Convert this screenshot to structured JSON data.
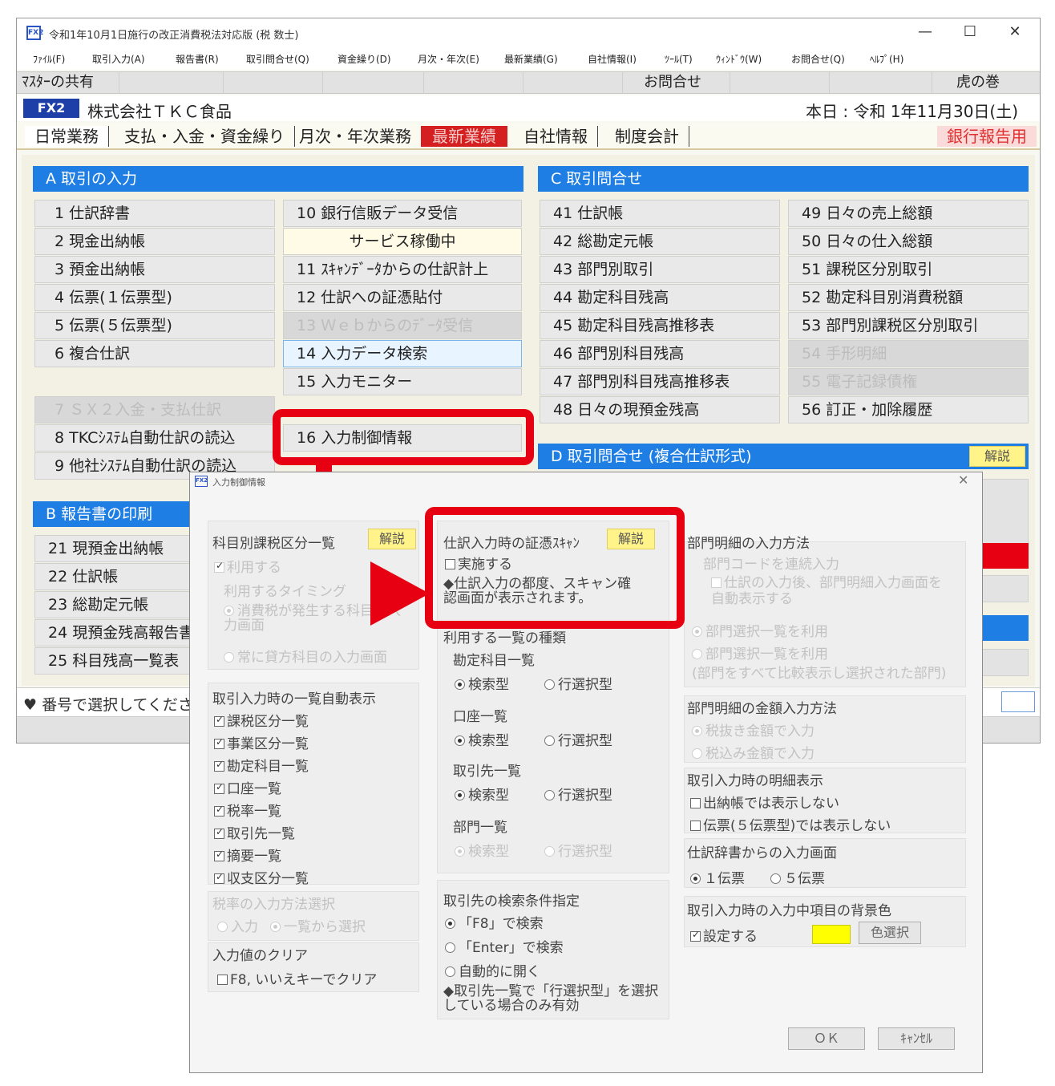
{
  "window": {
    "icon": "FX2",
    "title": "令和1年10月1日施行の改正消費税法対応版 (税 数士)",
    "controls": [
      "—",
      "☐",
      "✕"
    ]
  },
  "menu": [
    "ﾌｧｲﾙ(F)",
    "取引入力(A)",
    "報告書(R)",
    "取引問合せ(Q)",
    "資金繰り(D)",
    "月次・年次(E)",
    "最新業績(G)",
    "自社情報(I)",
    "ﾂｰﾙ(T)",
    "ｳｨﾝﾄﾞｳ(W)",
    "お問合せ(Q)",
    "ﾍﾙﾌﾟ(H)"
  ],
  "sharebar": {
    "label": "ﾏｽﾀｰの共有",
    "inquiry": "お問合せ",
    "tora": "虎の巻"
  },
  "company": {
    "badge": "FX2",
    "name": "株式会社ＴＫＣ食品",
    "today": "本日 : 令和 1年11月30日(土)"
  },
  "tabs": [
    "日常業務",
    "支払・入金・資金繰り",
    "月次・年次業務",
    "最新業績",
    "自社情報",
    "制度会計"
  ],
  "report_tab": "銀行報告用",
  "sectionA": {
    "title": "A 取引の入力",
    "left": [
      "1 仕訳辞書",
      "2 現金出納帳",
      "3 預金出納帳",
      "4 伝票(１伝票型)",
      "5 伝票(５伝票型)",
      "6 複合仕訳"
    ],
    "right": [
      "10 銀行信販データ受信",
      "サービス稼働中",
      "11 ｽｷｬﾝﾃﾞｰﾀからの仕訳計上",
      "12 仕訳への証憑貼付",
      "13 Ｗｅｂからのﾃﾞｰﾀ受信",
      "14 入力データ検索",
      "15 入力モニター"
    ],
    "left2": [
      "7 ＳＸ２入金・支払仕訳",
      "8 TKCｼｽﾃﾑ自動仕訳の読込",
      "9 他社ｼｽﾃﾑ自動仕訳の読込"
    ],
    "highlight": "16 入力制御情報"
  },
  "sectionB": {
    "title": "B 報告書の印刷",
    "items": [
      "21 現預金出納帳",
      "22 仕訳帳",
      "23 総勘定元帳",
      "24 現預金残高報告書",
      "25 科目残高一覧表"
    ]
  },
  "sectionC": {
    "title": "C 取引問合せ",
    "col1": [
      "41 仕訳帳",
      "42 総勘定元帳",
      "43 部門別取引",
      "44 勘定科目残高",
      "45 勘定科目残高推移表",
      "46 部門別科目残高",
      "47 部門別科目残高推移表",
      "48 日々の現預金残高"
    ],
    "col2": [
      "49 日々の売上総額",
      "50 日々の仕入総額",
      "51 課税区分別取引",
      "52 勘定科目別消費税額",
      "53 部門別課税区分別取引",
      "54 手形明細",
      "55 電子記録債権",
      "56 訂正・加除履歴"
    ]
  },
  "sectionD": {
    "title": "D 取引問合せ (複合仕訳形式)",
    "help": "解説"
  },
  "status": "♥ 番号で選択してください",
  "dialog": {
    "icon": "FX2",
    "title": "入力制御情報",
    "close": "✕",
    "col1": {
      "g1_title": "科目別課税区分一覧",
      "help": "解説",
      "use": "利用する",
      "type_title": "利用するタイミング",
      "opt1": "消費税が発生する科目の入力画面",
      "opt2": "常に貸方科目の入力画面",
      "g2_title": "取引入力時の一覧自動表示",
      "list": [
        "課税区分一覧",
        "事業区分一覧",
        "勘定科目一覧",
        "口座一覧",
        "税率一覧",
        "取引先一覧",
        "摘要一覧",
        "収支区分一覧"
      ],
      "g3_title": "税率の入力方法選択",
      "g3_opts": [
        "入力",
        "一覧から選択"
      ],
      "g4_title": "入力値のクリア",
      "g4_opt": "F8, いいえキーでクリア"
    },
    "col2": {
      "g1_title": "仕訳入力時の証憑ｽｷｬﾝ",
      "help": "解説",
      "do": "実施する",
      "note": "◆仕訳入力の都度、スキャン確認画面が表示されます。",
      "g2_title": "利用する一覧の種類",
      "groups": [
        {
          "name": "勘定科目一覧",
          "a": "検索型",
          "b": "行選択型"
        },
        {
          "name": "口座一覧",
          "a": "検索型",
          "b": "行選択型"
        },
        {
          "name": "取引先一覧",
          "a": "検索型",
          "b": "行選択型"
        },
        {
          "name": "部門一覧",
          "a": "検索型",
          "b": "行選択型"
        }
      ],
      "g3_title": "取引先の検索条件指定",
      "g3_opts": [
        "「F8」で検索",
        "「Enter」で検索",
        "自動的に開く"
      ],
      "g3_note": "◆取引先一覧で「行選択型」を選択している場合のみ有効"
    },
    "col3": {
      "g1_title": "部門明細の入力方法",
      "g1_opt1": "部門コードを連続入力",
      "g1_opt2": "仕訳の入力後、部門明細入力画面を自動表示する",
      "g1_opt3": "部門選択一覧を利用",
      "g1_opt4": "部門選択一覧を利用",
      "g1_opt4b": "(部門をすべて比較表示し選択された部門)",
      "g2_title": "部門明細の金額入力方法",
      "g2_opts": [
        "税抜き金額で入力",
        "税込み金額で入力"
      ],
      "g3_title": "取引入力時の明細表示",
      "g3_opts": [
        "出納帳では表示しない",
        "伝票(５伝票型)では表示しない"
      ],
      "g4_title": "仕訳辞書からの入力画面",
      "g4_opts": [
        "１伝票",
        "５伝票"
      ],
      "g5_title": "取引入力時の入力中項目の背景色",
      "g5_opt": "設定する",
      "g5_color": "#ffff00",
      "g5_btn": "色選択"
    },
    "ok": "ＯＫ",
    "cancel": "ｷｬﾝｾﾙ"
  },
  "colors": {
    "accent_blue": "#1e7ee4",
    "annotation_red": "#e60012",
    "fx2_badge": "#1f3fa8"
  }
}
